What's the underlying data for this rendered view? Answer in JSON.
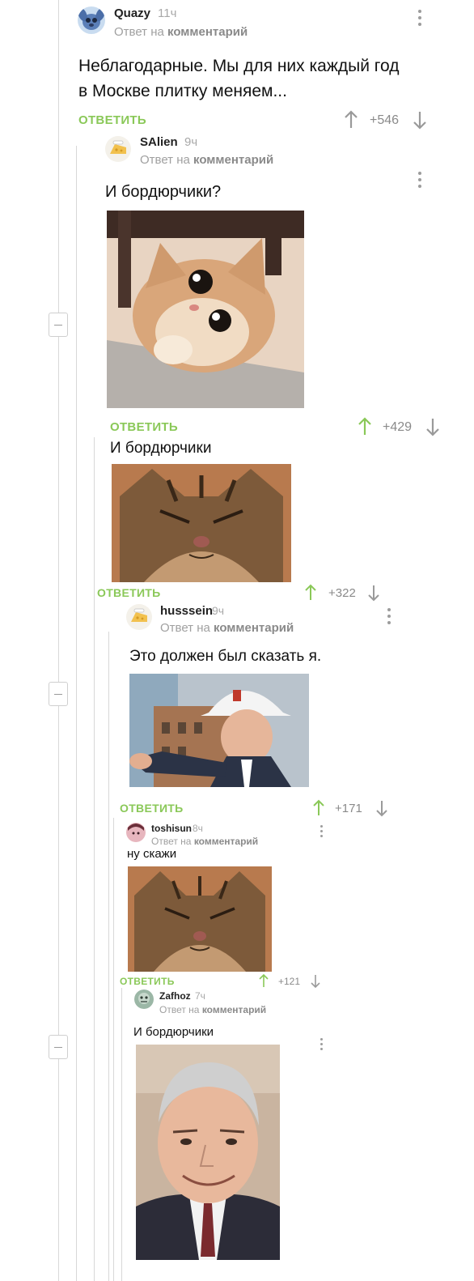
{
  "vote_colors": {
    "up_active": "#8ac858",
    "up_inactive": "#9a9a9a",
    "down": "#9a9a9a",
    "reply": "#8ac858"
  },
  "reply_word": "Ответ на",
  "comment_word": "комментарий",
  "comments": [
    {
      "username": "Quazy",
      "time": "11ч",
      "text_lines": [
        "Неблагодарные. Мы для них каждый год",
        "в Москве плитку меняем..."
      ],
      "reply_label": "ОТВЕТИТЬ",
      "rating": "+546",
      "avatar_icon": "stitch-avatar-icon"
    },
    {
      "username": "SAlien",
      "time": "9ч",
      "text": "И бордюрчики?",
      "reply_label": "ОТВЕТИТЬ",
      "rating": "+429",
      "image": "cat-peeking-under-table-image",
      "avatar_icon": "cheese-avatar-icon"
    },
    {
      "text": "И бордюрчики",
      "reply_label": "ОТВЕТИТЬ",
      "rating": "+322",
      "image": "smug-tabby-cat-image"
    },
    {
      "username": "husssein",
      "time": "9ч",
      "text": "Это должен был сказать я.",
      "reply_label": "ОТВЕТИТЬ",
      "rating": "+171",
      "image": "man-in-hard-hat-pointing-image",
      "avatar_icon": "cheese-avatar-icon"
    },
    {
      "username": "toshisun",
      "time": "8ч",
      "text": "ну скажи",
      "reply_label": "ОТВЕТИТЬ",
      "rating": "+121",
      "image": "smug-tabby-cat-image",
      "avatar_icon": "anime-avatar-icon"
    },
    {
      "username": "Zafhoz",
      "time": "7ч",
      "text": "И бордюрчики",
      "image": "smiling-gray-haired-man-image",
      "avatar_icon": "zombie-avatar-icon"
    }
  ]
}
